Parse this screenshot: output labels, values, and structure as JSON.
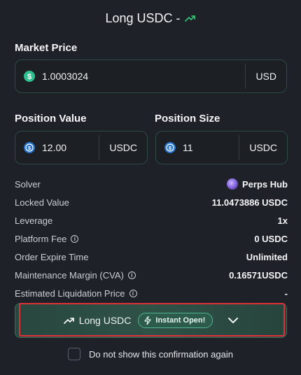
{
  "header": {
    "title": "Long USDC -",
    "trend_icon": "trend-up-icon",
    "accent": "#2fbf71"
  },
  "market_price": {
    "label": "Market Price",
    "value": "1.0003024",
    "unit": "USD",
    "icon": "dollar-coin-icon"
  },
  "position_value": {
    "label": "Position Value",
    "value": "12.00",
    "unit": "USDC",
    "icon": "usdc-icon"
  },
  "position_size": {
    "label": "Position Size",
    "value": "11",
    "unit": "USDC",
    "icon": "usdc-icon"
  },
  "details": [
    {
      "key": "Solver",
      "value": "Perps Hub",
      "info": false,
      "icon": "perps-hub-icon"
    },
    {
      "key": "Locked Value",
      "value": "11.0473886 USDC",
      "info": false
    },
    {
      "key": "Leverage",
      "value": "1x",
      "info": false
    },
    {
      "key": "Platform Fee",
      "value": "0 USDC",
      "info": true
    },
    {
      "key": "Order Expire Time",
      "value": "Unlimited",
      "info": false
    },
    {
      "key": "Maintenance Margin (CVA)",
      "value": "0.16571USDC",
      "info": true
    },
    {
      "key": "Estimated Liquidation Price",
      "value": "-",
      "info": true
    }
  ],
  "cta": {
    "label": "Long USDC",
    "badge": "Instant Open!",
    "colors": {
      "highlight": "#e0303a"
    }
  },
  "confirm": {
    "text": "Do not show this confirmation again",
    "checked": false
  }
}
